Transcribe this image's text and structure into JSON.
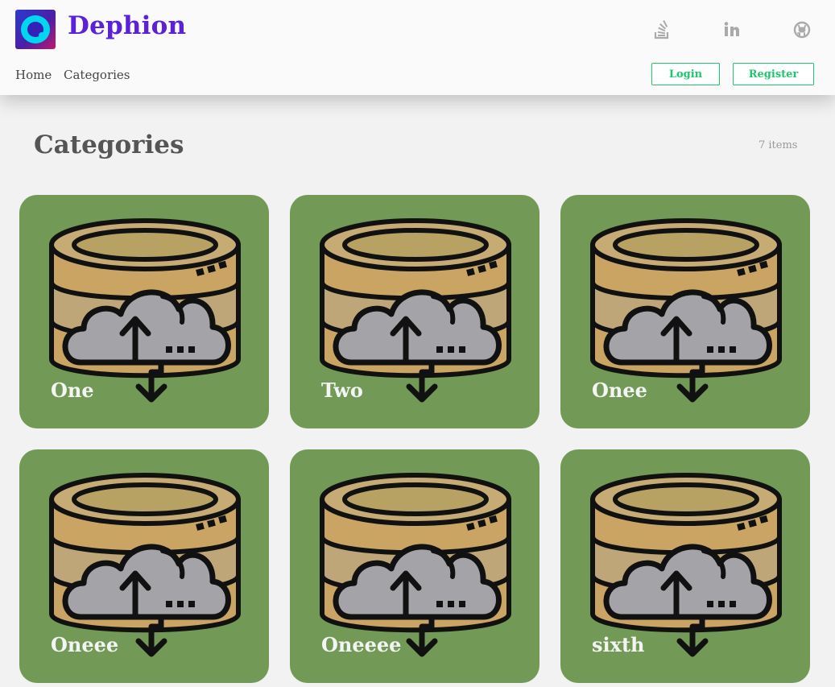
{
  "header": {
    "brand": "Dephion",
    "nav": [
      "Home",
      "Categories"
    ],
    "social_icons": [
      "stackoverflow-icon",
      "linkedin-icon",
      "github-icon"
    ],
    "login_label": "Login",
    "register_label": "Register",
    "accent_color": "#5b21d6",
    "button_color": "#1dc86a"
  },
  "main": {
    "title": "Categories",
    "count": "7 items",
    "card_color": "#729a56",
    "cards": [
      {
        "label": "One"
      },
      {
        "label": "Two"
      },
      {
        "label": "Onee"
      },
      {
        "label": "Oneee"
      },
      {
        "label": "Oneeee"
      },
      {
        "label": "sixth"
      }
    ]
  }
}
